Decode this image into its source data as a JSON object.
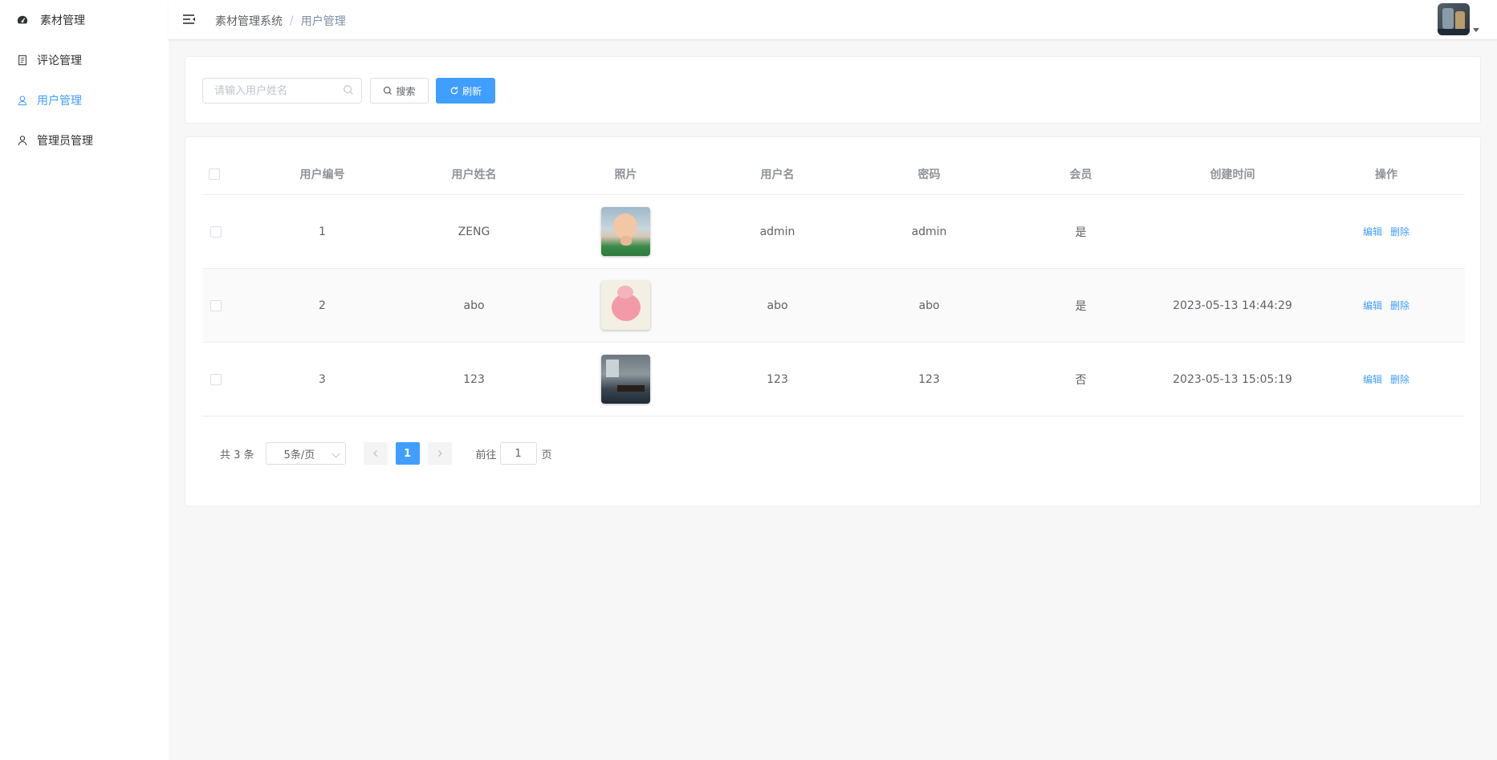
{
  "sidebar": {
    "logo_label": "素材管理",
    "items": [
      {
        "label": "评论管理"
      },
      {
        "label": "用户管理"
      },
      {
        "label": "管理员管理"
      }
    ]
  },
  "header": {
    "breadcrumb": [
      "素材管理系统",
      "用户管理"
    ],
    "breadcrumb_separator": "/"
  },
  "search": {
    "placeholder": "请输入用户姓名",
    "value": "",
    "search_label": "搜索",
    "refresh_label": "刷新"
  },
  "table": {
    "headers": [
      "用户编号",
      "用户姓名",
      "照片",
      "用户名",
      "密码",
      "会员",
      "创建时间",
      "操作"
    ],
    "rows": [
      {
        "id": "1",
        "name": "ZENG",
        "username": "admin",
        "password": "admin",
        "member": "是",
        "created": ""
      },
      {
        "id": "2",
        "name": "abo",
        "username": "abo",
        "password": "abo",
        "member": "是",
        "created": "2023-05-13 14:44:29"
      },
      {
        "id": "3",
        "name": "123",
        "username": "123",
        "password": "123",
        "member": "否",
        "created": "2023-05-13 15:05:19"
      }
    ],
    "edit_label": "编辑",
    "delete_label": "删除"
  },
  "pagination": {
    "total_text": "共 3 条",
    "page_size": "5条/页",
    "current_page": "1",
    "goto_prefix": "前往",
    "goto_value": "1",
    "goto_suffix": "页"
  },
  "colors": {
    "primary": "#409eff",
    "sidebar_bg": "#ffffff",
    "page_bg": "#f7f7f7"
  }
}
